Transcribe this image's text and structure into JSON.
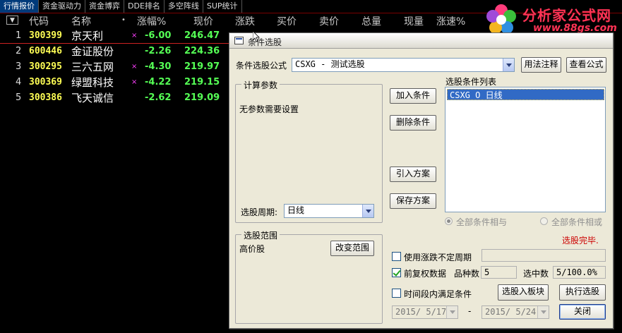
{
  "tabs": [
    "行情报价",
    "资金驱动力",
    "资金博弈",
    "DDE排名",
    "多空阵线",
    "SUP统计"
  ],
  "columns": [
    "代码",
    "名称",
    "•",
    "涨幅%",
    "现价",
    "涨跌",
    "买价",
    "卖价",
    "总量",
    "现量",
    "涨速%"
  ],
  "rows": [
    {
      "num": "1",
      "code": "300399",
      "name": "京天利",
      "mark": "×",
      "chg": "-6.00",
      "price": "246.47"
    },
    {
      "num": "2",
      "code": "600446",
      "name": "金证股份",
      "mark": "",
      "chg": "-2.26",
      "price": "224.36"
    },
    {
      "num": "3",
      "code": "300295",
      "name": "三六五网",
      "mark": "×",
      "chg": "-4.30",
      "price": "219.97"
    },
    {
      "num": "4",
      "code": "300369",
      "name": "绿盟科技",
      "mark": "×",
      "chg": "-4.22",
      "price": "219.15"
    },
    {
      "num": "5",
      "code": "300386",
      "name": "飞天诚信",
      "mark": "",
      "chg": "-2.62",
      "price": "219.09"
    }
  ],
  "logo": {
    "brand": "分析家公式网",
    "url": "www.88gs.com"
  },
  "dialog": {
    "title": "条件选股",
    "formula_label": "条件选股公式",
    "formula_value": "CSXG     - 测试选股",
    "syntax_btn": "用法注释",
    "view_btn": "查看公式",
    "params_group": "计算参数",
    "no_params": "无参数需要设置",
    "period_label": "选股周期:",
    "period_value": "日线",
    "add_btn": "加入条件",
    "del_btn": "删除条件",
    "import_btn": "引入方案",
    "save_btn": "保存方案",
    "list_label": "选股条件列表",
    "list_items": [
      "CSXG  O  日线"
    ],
    "radio_and": "全部条件相与",
    "radio_or": "全部条件相或",
    "status": "选股完毕.",
    "range_group": "选股范围",
    "range_value": "高价股",
    "change_range_btn": "改变范围",
    "chk_variable": "使用涨跌不定周期",
    "chk_adjust": "前复权数据",
    "count_label": "品种数",
    "count_value": "5",
    "selected_label": "选中数",
    "selected_value": "5/100.0%",
    "chk_time": "时间段内满足条件",
    "to_block_btn": "选股入板块",
    "run_btn": "执行选股",
    "date_from": "2015/ 5/17",
    "date_sep": "-",
    "date_to": "2015/ 5/24",
    "close_btn": "关闭"
  }
}
